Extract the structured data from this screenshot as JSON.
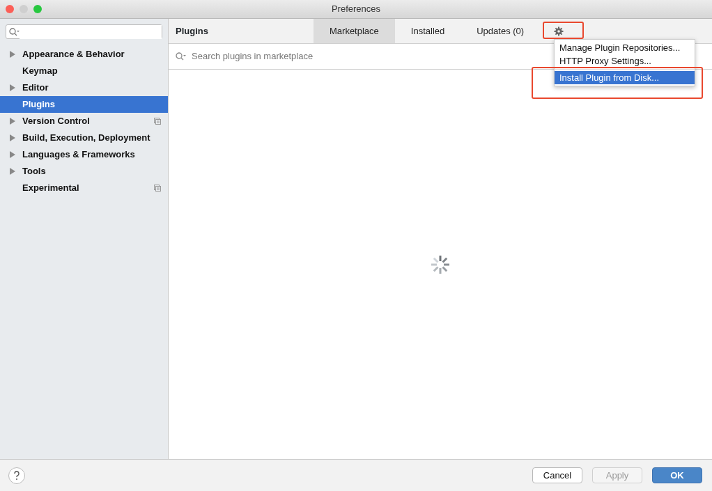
{
  "window": {
    "title": "Preferences"
  },
  "sidebar": {
    "items": [
      {
        "label": "Appearance & Behavior",
        "expandable": true,
        "selected": false,
        "project_level": false
      },
      {
        "label": "Keymap",
        "expandable": false,
        "selected": false,
        "project_level": false
      },
      {
        "label": "Editor",
        "expandable": true,
        "selected": false,
        "project_level": false
      },
      {
        "label": "Plugins",
        "expandable": false,
        "selected": true,
        "project_level": false
      },
      {
        "label": "Version Control",
        "expandable": true,
        "selected": false,
        "project_level": true
      },
      {
        "label": "Build, Execution, Deployment",
        "expandable": true,
        "selected": false,
        "project_level": false
      },
      {
        "label": "Languages & Frameworks",
        "expandable": true,
        "selected": false,
        "project_level": false
      },
      {
        "label": "Tools",
        "expandable": true,
        "selected": false,
        "project_level": false
      },
      {
        "label": "Experimental",
        "expandable": false,
        "selected": false,
        "project_level": true
      }
    ]
  },
  "header": {
    "title": "Plugins",
    "tabs": [
      {
        "label": "Marketplace",
        "selected": true
      },
      {
        "label": "Installed",
        "selected": false
      },
      {
        "label": "Updates (0)",
        "selected": false
      }
    ]
  },
  "search": {
    "placeholder": "Search plugins in marketplace"
  },
  "menu": {
    "items": [
      {
        "label": "Manage Plugin Repositories...",
        "selected": false,
        "separator_before": false
      },
      {
        "label": "HTTP Proxy Settings...",
        "selected": false,
        "separator_before": false
      },
      {
        "label": "Install Plugin from Disk...",
        "selected": true,
        "separator_before": true
      }
    ]
  },
  "content": {
    "loading": true
  },
  "buttons": [
    {
      "label": "Cancel",
      "kind": "normal",
      "disabled": false
    },
    {
      "label": "Apply",
      "kind": "normal",
      "disabled": true
    },
    {
      "label": "OK",
      "kind": "default",
      "disabled": false
    }
  ]
}
